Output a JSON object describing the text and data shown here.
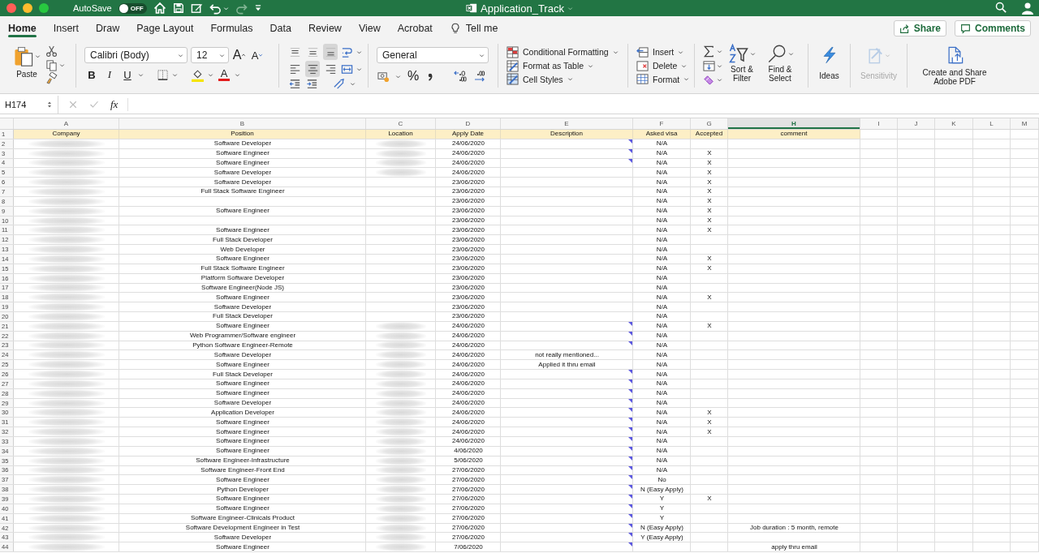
{
  "title_bar": {
    "autosave": {
      "label": "AutoSave",
      "state": "OFF",
      "on": false
    },
    "title": "Application_Track"
  },
  "tabs": [
    {
      "label": "Home",
      "selected": true
    },
    {
      "label": "Insert",
      "selected": false
    },
    {
      "label": "Draw",
      "selected": false
    },
    {
      "label": "Page Layout",
      "selected": false
    },
    {
      "label": "Formulas",
      "selected": false
    },
    {
      "label": "Data",
      "selected": false
    },
    {
      "label": "Review",
      "selected": false
    },
    {
      "label": "View",
      "selected": false
    },
    {
      "label": "Acrobat",
      "selected": false
    }
  ],
  "tell_me": "Tell me",
  "share": "Share",
  "comments": "Comments",
  "ribbon": {
    "paste": "Paste",
    "font_name": "Calibri (Body)",
    "font_size": "12",
    "grow_font": "A",
    "shrink_font": "A",
    "bold": "B",
    "italic": "I",
    "underline": "U",
    "font_color": "A",
    "vertical_align": [
      {
        "selected": false
      },
      {
        "selected": false
      },
      {
        "selected": true
      }
    ],
    "horizontal_align": [
      {
        "selected": false
      },
      {
        "selected": true
      },
      {
        "selected": false
      }
    ],
    "number_format": "General",
    "percent": "%",
    "styles": [
      "Conditional Formatting",
      "Format as Table",
      "Cell Styles"
    ],
    "cells": [
      "Insert",
      "Delete",
      "Format"
    ],
    "sort": "Sort & Filter",
    "find": "Find & Select",
    "ideas": "Ideas",
    "sensitivity": {
      "label": "Sensitivity",
      "disabled": true
    },
    "adobe": "Create and Share Adobe PDF"
  },
  "formula_bar": {
    "name_box": "H174",
    "fx": "fx"
  },
  "sheet": {
    "columns": [
      {
        "letter": "A",
        "selected": false
      },
      {
        "letter": "B",
        "selected": false
      },
      {
        "letter": "C",
        "selected": false
      },
      {
        "letter": "D",
        "selected": false
      },
      {
        "letter": "E",
        "selected": false
      },
      {
        "letter": "F",
        "selected": false
      },
      {
        "letter": "G",
        "selected": false
      },
      {
        "letter": "H",
        "selected": true
      },
      {
        "letter": "I",
        "selected": false
      },
      {
        "letter": "J",
        "selected": false
      },
      {
        "letter": "K",
        "selected": false
      },
      {
        "letter": "L",
        "selected": false
      },
      {
        "letter": "M",
        "selected": false
      }
    ],
    "header_row": {
      "number": "1",
      "cells": [
        "Company",
        "Position",
        "Location",
        "Apply Date",
        "Description",
        "Asked visa",
        "Accepted",
        "comment"
      ]
    },
    "rows": [
      {
        "number": "2",
        "company_redacted": true,
        "position": "Software Developer",
        "location_redacted": true,
        "apply_date": "24/06/2020",
        "note": true,
        "asked_visa": "N/A"
      },
      {
        "number": "3",
        "company_redacted": true,
        "position": "Software Engineer",
        "location_redacted": true,
        "apply_date": "24/06/2020",
        "note": true,
        "asked_visa": "N/A",
        "accepted": "X"
      },
      {
        "number": "4",
        "company_redacted": true,
        "position": "Software Engineer",
        "location_redacted": true,
        "apply_date": "24/06/2020",
        "note": true,
        "asked_visa": "N/A",
        "accepted": "X"
      },
      {
        "number": "5",
        "company_redacted": true,
        "position": "Software Developer",
        "location_redacted": true,
        "apply_date": "24/06/2020",
        "note": false,
        "asked_visa": "N/A",
        "accepted": "X"
      },
      {
        "number": "6",
        "company_redacted": true,
        "position": "Software Developer",
        "location_redacted": false,
        "apply_date": "23/06/2020",
        "note": false,
        "asked_visa": "N/A",
        "accepted": "X"
      },
      {
        "number": "7",
        "company_redacted": true,
        "position": "Full Stack Software Engineer",
        "location_redacted": false,
        "apply_date": "23/06/2020",
        "note": false,
        "asked_visa": "N/A",
        "accepted": "X"
      },
      {
        "number": "8",
        "company_redacted": true,
        "location_redacted": false,
        "apply_date": "23/06/2020",
        "note": false,
        "asked_visa": "N/A",
        "accepted": "X"
      },
      {
        "number": "9",
        "company_redacted": true,
        "position": "Software Engineer",
        "location_redacted": false,
        "apply_date": "23/06/2020",
        "note": false,
        "asked_visa": "N/A",
        "accepted": "X"
      },
      {
        "number": "10",
        "company_redacted": true,
        "location_redacted": false,
        "apply_date": "23/06/2020",
        "note": false,
        "asked_visa": "N/A",
        "accepted": "X"
      },
      {
        "number": "11",
        "company_redacted": true,
        "position": "Software Engineer",
        "location_redacted": false,
        "apply_date": "23/06/2020",
        "note": false,
        "asked_visa": "N/A",
        "accepted": "X"
      },
      {
        "number": "12",
        "company_redacted": true,
        "position": "Full Stack Developer",
        "location_redacted": false,
        "apply_date": "23/06/2020",
        "note": false,
        "asked_visa": "N/A"
      },
      {
        "number": "13",
        "company_redacted": true,
        "position": "Web Developer",
        "location_redacted": false,
        "apply_date": "23/06/2020",
        "note": false,
        "asked_visa": "N/A"
      },
      {
        "number": "14",
        "company_redacted": true,
        "position": "Software Engineer",
        "location_redacted": false,
        "apply_date": "23/06/2020",
        "note": false,
        "asked_visa": "N/A",
        "accepted": "X"
      },
      {
        "number": "15",
        "company_redacted": true,
        "position": "Full Stack Software Engineer",
        "location_redacted": false,
        "apply_date": "23/06/2020",
        "note": false,
        "asked_visa": "N/A",
        "accepted": "X"
      },
      {
        "number": "16",
        "company_redacted": true,
        "position": "Platform Software Developer",
        "location_redacted": false,
        "apply_date": "23/06/2020",
        "note": false,
        "asked_visa": "N/A"
      },
      {
        "number": "17",
        "company_redacted": true,
        "position": "Software Engineer(Node JS)",
        "location_redacted": false,
        "apply_date": "23/06/2020",
        "note": false,
        "asked_visa": "N/A"
      },
      {
        "number": "18",
        "company_redacted": true,
        "position": "Software Engineer",
        "location_redacted": false,
        "apply_date": "23/06/2020",
        "note": false,
        "asked_visa": "N/A",
        "accepted": "X"
      },
      {
        "number": "19",
        "company_redacted": true,
        "position": "Software Developer",
        "location_redacted": false,
        "apply_date": "23/06/2020",
        "note": false,
        "asked_visa": "N/A"
      },
      {
        "number": "20",
        "company_redacted": true,
        "position": "Full Stack Developer",
        "location_redacted": false,
        "apply_date": "23/06/2020",
        "note": false,
        "asked_visa": "N/A"
      },
      {
        "number": "21",
        "company_redacted": true,
        "position": "Software Engineer",
        "location_redacted": true,
        "apply_date": "24/06/2020",
        "note": true,
        "asked_visa": "N/A",
        "accepted": "X"
      },
      {
        "number": "22",
        "company_redacted": true,
        "position": "Web Programmer/Software engineer",
        "location_redacted": true,
        "apply_date": "24/06/2020",
        "note": true,
        "asked_visa": "N/A"
      },
      {
        "number": "23",
        "company_redacted": true,
        "position": "Python Software Engineer-Remote",
        "location_redacted": true,
        "apply_date": "24/06/2020",
        "note": true,
        "asked_visa": "N/A"
      },
      {
        "number": "24",
        "company_redacted": true,
        "position": "Software Developer",
        "location_redacted": true,
        "apply_date": "24/06/2020",
        "description": "not really mentioned...",
        "note": false,
        "asked_visa": "N/A"
      },
      {
        "number": "25",
        "company_redacted": true,
        "position": "Software Engineer",
        "location_redacted": true,
        "apply_date": "24/06/2020",
        "description": "Applied it thru email",
        "note": false,
        "asked_visa": "N/A"
      },
      {
        "number": "26",
        "company_redacted": true,
        "position": "Full Stack Developer",
        "location_redacted": true,
        "apply_date": "24/06/2020",
        "note": true,
        "asked_visa": "N/A"
      },
      {
        "number": "27",
        "company_redacted": true,
        "position": "Software Engineer",
        "location_redacted": true,
        "apply_date": "24/06/2020",
        "note": true,
        "asked_visa": "N/A"
      },
      {
        "number": "28",
        "company_redacted": true,
        "position": "Software Engineer",
        "location_redacted": true,
        "apply_date": "24/06/2020",
        "note": true,
        "asked_visa": "N/A"
      },
      {
        "number": "29",
        "company_redacted": true,
        "position": "Software Developer",
        "location_redacted": true,
        "apply_date": "24/06/2020",
        "note": true,
        "asked_visa": "N/A"
      },
      {
        "number": "30",
        "company_redacted": true,
        "position": "Application Developer",
        "location_redacted": true,
        "apply_date": "24/06/2020",
        "note": true,
        "asked_visa": "N/A",
        "accepted": "X"
      },
      {
        "number": "31",
        "company_redacted": true,
        "position": "Software Engineer",
        "location_redacted": true,
        "apply_date": "24/06/2020",
        "note": true,
        "asked_visa": "N/A",
        "accepted": "X"
      },
      {
        "number": "32",
        "company_redacted": true,
        "position": "Software Engineer",
        "location_redacted": true,
        "apply_date": "24/06/2020",
        "note": true,
        "asked_visa": "N/A",
        "accepted": "X"
      },
      {
        "number": "33",
        "company_redacted": true,
        "position": "Software Engineer",
        "location_redacted": true,
        "apply_date": "24/06/2020",
        "note": true,
        "asked_visa": "N/A"
      },
      {
        "number": "34",
        "company_redacted": true,
        "position": "Software Engineer",
        "location_redacted": true,
        "apply_date": "4/06/2020",
        "note": true,
        "asked_visa": "N/A"
      },
      {
        "number": "35",
        "company_redacted": true,
        "position": "Software Engineer-Infrastructure",
        "location_redacted": true,
        "apply_date": "5/06/2020",
        "note": true,
        "asked_visa": "N/A"
      },
      {
        "number": "36",
        "company_redacted": true,
        "position": "Software Engineer-Front End",
        "location_redacted": true,
        "apply_date": "27/06/2020",
        "note": true,
        "asked_visa": "N/A"
      },
      {
        "number": "37",
        "company_redacted": true,
        "position": "Software Engineer",
        "location_redacted": true,
        "apply_date": "27/06/2020",
        "note": true,
        "asked_visa": "No"
      },
      {
        "number": "38",
        "company_redacted": true,
        "position": "Python Developer",
        "location_redacted": true,
        "apply_date": "27/06/2020",
        "note": true,
        "asked_visa": "N (Easy Apply)"
      },
      {
        "number": "39",
        "company_redacted": true,
        "position": "Software Engineer",
        "location_redacted": true,
        "apply_date": "27/06/2020",
        "note": true,
        "asked_visa": "Y",
        "accepted": "X"
      },
      {
        "number": "40",
        "company_redacted": true,
        "position": "Software Engineer",
        "location_redacted": true,
        "apply_date": "27/06/2020",
        "note": true,
        "asked_visa": "Y"
      },
      {
        "number": "41",
        "company_redacted": true,
        "position": "Software Engineer-Clinicals Product",
        "location_redacted": true,
        "apply_date": "27/06/2020",
        "note": true,
        "asked_visa": "Y"
      },
      {
        "number": "42",
        "company_redacted": true,
        "position": "Software Development Engineer in Test",
        "location_redacted": true,
        "apply_date": "27/06/2020",
        "note": true,
        "asked_visa": "N (Easy Apply)",
        "comment": "Job duration : 5 month, remote"
      },
      {
        "number": "43",
        "company_redacted": true,
        "position": "Software Developer",
        "location_redacted": true,
        "apply_date": "27/06/2020",
        "note": true,
        "asked_visa": "Y (Easy Apply)"
      },
      {
        "number": "44",
        "company_redacted": true,
        "position": "Software Engineer",
        "location_redacted": true,
        "apply_date": "7/06/2020",
        "note": true,
        "comment": "apply thru email"
      }
    ]
  }
}
